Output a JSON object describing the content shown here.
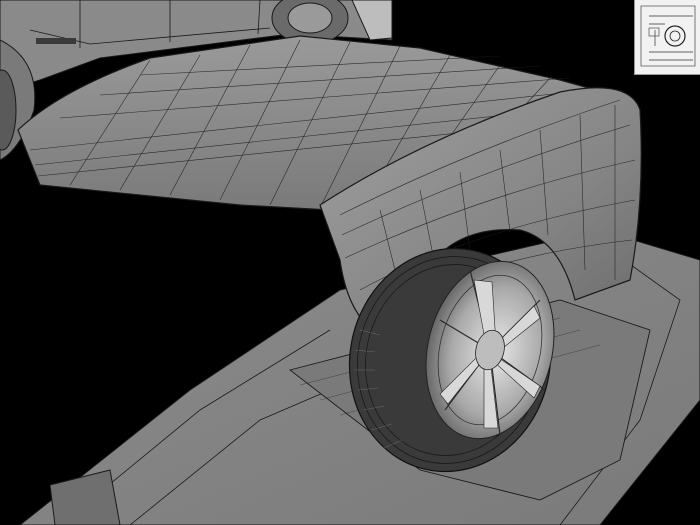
{
  "scene": {
    "subject": "car-body-wireframe",
    "colors": {
      "background": "#000000",
      "surface": "#8a8a8a",
      "surface_dark": "#5e5e5e",
      "surface_light": "#a8a8a8",
      "wire": "#1a1a1a",
      "tire": "#3a3a3a",
      "rim": "#c8c8c8",
      "reference_paper": "#f2f2f2"
    }
  }
}
